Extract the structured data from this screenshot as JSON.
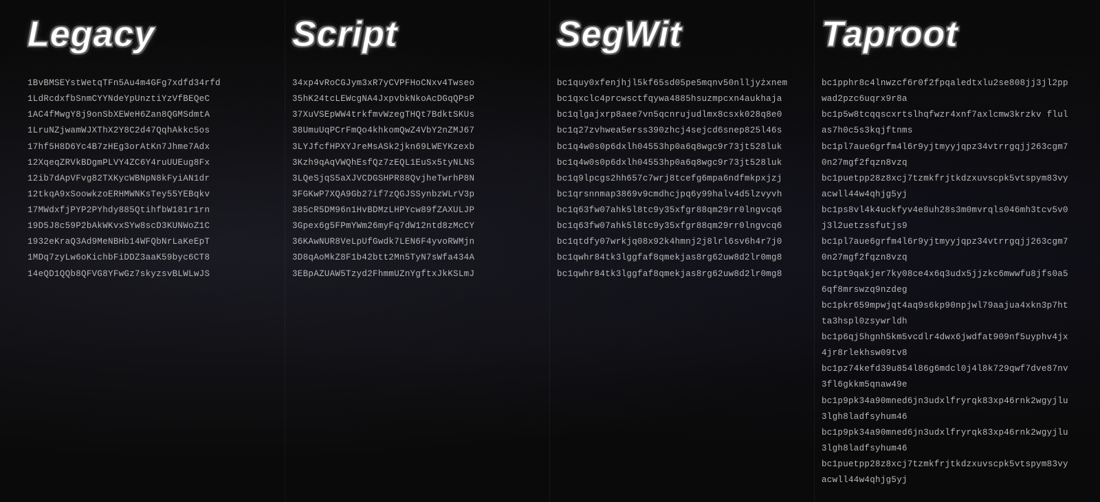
{
  "columns": [
    {
      "id": "legacy",
      "title": "Legacy",
      "addresses": [
        "1BvBMSEYstWetqTFn5Au4m4GFg7xdfd34rfd",
        "1LdRcdxfbSnmCYYNdeYpUnztiYzVfBEQeC",
        "1AC4fMwgY8j9onSbXEWeH6Zan8QGMSdmtA",
        "1LruNZjwamWJXThX2Y8C2d47QqhAkkc5os",
        "17hf5H8D6Yc4B7zHEg3orAtKn7Jhme7Adx",
        "12XqeqZRVkBDgmPLVY4ZC6Y4ruUUEug8Fx",
        "12ib7dApVFvg82TXKycWBNpN8kFyiAN1dr",
        "12tkqA9xSoowkzoERHMWNKsTey55YEBqkv",
        "17MWdxfjPYP2PYhdy885QtihfbW181r1rn",
        "19D5J8c59P2bAkWKvxSYw8scD3KUNWoZ1C",
        "1932eKraQ3Ad9MeNBHb14WFQbNrLaKeEpT",
        "1MDq7zyLw6oKichbFiDDZ3aaK59byc6CT8",
        "14eQD1QQb8QFVG8YFwGz7skyzsvBLWLwJS"
      ]
    },
    {
      "id": "script",
      "title": "Script",
      "addresses": [
        "34xp4vRoCGJym3xR7yCVPFHoCNxv4Twseo",
        "35hK24tcLEWcgNA4JxpvbkNkoAcDGqQPsP",
        "37XuVSEpWW4trkfmvWzegTHQt7BdktSKUs",
        "38UmuUqPCrFmQo4khkomQwZ4VbY2nZMJ67",
        "3LYJfcfHPXYJreMsASk2jkn69LWEYKzexb",
        "3Kzh9qAqVWQhEsfQz7zEQL1EuSx5tyNLNS",
        "3LQeSjqS5aXJVCDGSHPR88QvjheTwrhP8N",
        "3FGKwP7XQA9Gb27if7zQGJSSynbzWLrV3p",
        "385cR5DM96n1HvBDMzLHPYcw89fZAXULJP",
        "3Gpex6g5FPmYWm26myFq7dW12ntd8zMcCY",
        "36KAwNUR8VeLpUfGwdk7LEN6F4yvoRWMjn",
        "3D8qAoMkZ8F1b42btt2Mn5TyN7sWfa434A",
        "3EBpAZUAW5Tzyd2FhmmUZnYgftxJkKSLmJ"
      ]
    },
    {
      "id": "segwit",
      "title": "SegWit",
      "addresses": [
        "bc1quy0xfenjhjl5kf65sd05pe5mqnv50nlljyżxnem",
        "bc1qxclc4prcwsctfqywa4885hsuzmpcxn4aukhaja",
        "bc1qlgajxrp8aee7vn5qcnrujudlmx8csxk028q8e0",
        "bc1q27zvhwea5erss390zhcj4sejcd6snep825l46s",
        "bc1q4w0s0p6dxlh04553hp0a6q8wgc9r73jt528luk",
        "bc1q4w0s0p6dxlh04553hp0a6q8wgc9r73jt528luk",
        "bc1q9lpcgs2hh657c7wrj8tcefg6mpa6ndfmkpxjzj",
        "bc1qrsnnmap3869v9cmdhcjpq6y99halv4d5lzvyvh",
        "bc1q63fw07ahk5l8tc9y35xfgr88qm29rr0lngvcq6",
        "bc1q63fw07ahk5l8tc9y35xfgr88qm29rr0lngvcq6",
        "bc1qtdfy07wrkjq08x92k4hmnj2j8lrl6sv6h4r7j0",
        "bc1qwhr84tk3lggfaf8qmekjas8rg62uw8d2lr0mg8",
        "bc1qwhr84tk3lggfaf8qmekjas8rg62uw8d2lr0mg8"
      ]
    },
    {
      "id": "taproot",
      "title": "Taproot",
      "addresses": [
        "bc1pphr8c4lnwzcf6r0f2fpqaledtxlu2se808jj3jl2ppwad2pzc6uqrx9r8a",
        "bc1p5w8tcqqscxrtslhqfwzr4xnf7axlcmw3krzkv flulas7h0c5s3kqjftnms",
        "bc1pl7aue6grfm4l6r9yjtmyyjqpz34vtrrgqjj263cgm70n27mgf2fqzn8vzq",
        "bc1puetpp28z8xcj7tzmkfrjtkdzxuvscpk5vtspym83vyacwll44w4qhjg5yj",
        "bc1ps8vl4k4uckfyv4e8uh28s3m0mvrqls046mh3tcv5v0j3l2uetzssfutjs9",
        "bc1pl7aue6grfm4l6r9yjtmyyjqpz34vtrrgqjj263cgm70n27mgf2fqzn8vzq",
        "bc1pt9qakjer7ky08ce4x6q3udx5jjzkc6mwwfu8jfs0a56qf8mrswzq9nzdeg",
        "bc1pkr659mpwjqt4aq9s6kp90npjwl79aajua4xkn3p7htta3hspl0zsywrldh",
        "bc1p6qj5hgnh5km5vcdlr4dwx6jwdfat909nf5uyphv4jx4jr8rlekhsw09tv8",
        "bc1pz74kefd39u854l86g6mdcl0j4l8k729qwf7dve87nv3fl6gkkm5qnaw49e",
        "bc1p9pk34a90mned6jn3udxlfryrqk83xp46rnk2wgyjlu3lgh8ladfsyhum46",
        "bc1p9pk34a90mned6jn3udxlfryrqk83xp46rnk2wgyjlu3lgh8ladfsyhum46",
        "bc1puetpp28z8xcj7tzmkfrjtkdzxuvscpk5vtspym83vyacwll44w4qhjg5yj"
      ]
    }
  ]
}
